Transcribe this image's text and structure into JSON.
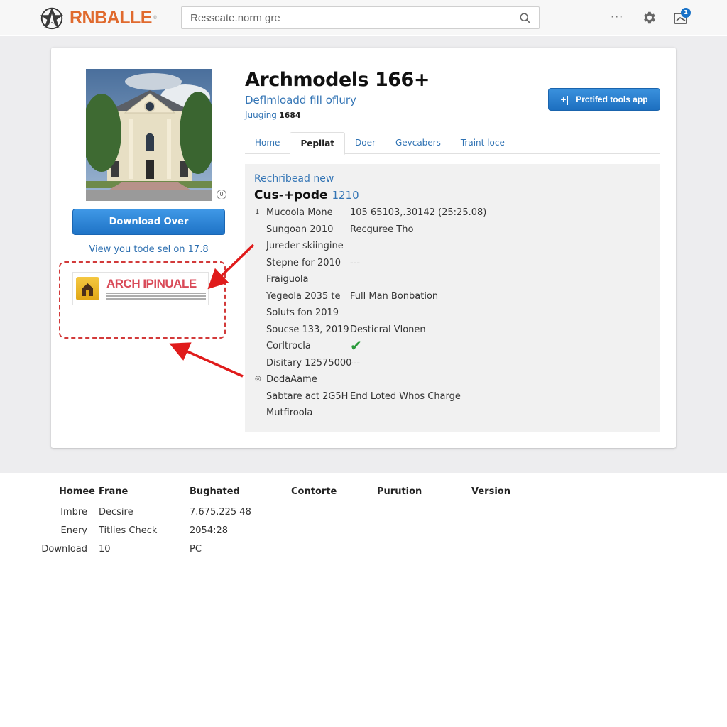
{
  "header": {
    "brand": "RNBALLE",
    "search": {
      "value": "Resscate.norm gre",
      "placeholder": ""
    },
    "more_label": "···",
    "notification_count": "1",
    "icons": [
      "brand-logo-icon",
      "search-icon",
      "more-icon",
      "gear-icon",
      "inbox-icon"
    ]
  },
  "product": {
    "title": "Archmodels 166+",
    "subtitle": "Deflmloadd fill oflury",
    "meta_label": "Juuging",
    "meta_value": "1684",
    "primary_button": "Prctifed tools app",
    "primary_button_icon": "+|",
    "download_button": "Download Over",
    "view_link": "View you tode sel on 17.8",
    "thumb_badge": "0"
  },
  "ad": {
    "title": "ARCH IPINUALE"
  },
  "tabs": [
    {
      "label": "Home",
      "active": false
    },
    {
      "label": "Pepliat",
      "active": true
    },
    {
      "label": "Doer",
      "active": false
    },
    {
      "label": "Gevcabers",
      "active": false
    },
    {
      "label": "Traint loce",
      "active": false
    }
  ],
  "details": {
    "heading": "Rechribead new",
    "subheading": "Cus-+pode",
    "subheading_number": "1210",
    "rows": [
      {
        "marker": "1",
        "key": "Mucoola Mone",
        "value": "105 65103,.30142 (25:25.08)"
      },
      {
        "marker": "",
        "key": "Sungoan 2010",
        "value": "Recguree Tho"
      },
      {
        "marker": "",
        "key": "Jureder skiingine",
        "value": ""
      },
      {
        "marker": "",
        "key": "Stepne for 2010",
        "value": "---"
      },
      {
        "marker": "",
        "key": "Fraiguola",
        "value": ""
      },
      {
        "marker": "",
        "key": "Yegeola 2035 te",
        "value": "Full Man Bonbation"
      },
      {
        "marker": "",
        "key": "Soluts fon 2019",
        "value": ""
      },
      {
        "marker": "",
        "key": "Soucse 133, 2019",
        "value": "Desticral Vlonen"
      },
      {
        "marker": "",
        "key": "Corltrocla",
        "value": "✔"
      },
      {
        "marker": "",
        "key": "Disitary 12575000",
        "value": "---"
      },
      {
        "marker": "◎",
        "key": "DodaAame",
        "value": ""
      },
      {
        "marker": "",
        "key": "Sabtare act 2G5H",
        "value": "End Loted Whos Charge"
      },
      {
        "marker": "",
        "key": "Mutfiroola",
        "value": ""
      }
    ]
  },
  "footer_table": {
    "headers": [
      "Homee",
      "Frane",
      "Bughated",
      "Contorte",
      "Purution",
      "Version"
    ],
    "rows": [
      [
        "Imbre",
        "Decsire",
        "7.675.225 48"
      ],
      [
        "Enery",
        "Titlies Check",
        "2054:28"
      ],
      [
        "Download",
        "10",
        "PC"
      ]
    ]
  },
  "colors": {
    "brand": "#e06a2e",
    "accent": "#1f73c6",
    "link": "#3475b5",
    "annotation": "#d23a3a",
    "check": "#2a9a3a"
  }
}
